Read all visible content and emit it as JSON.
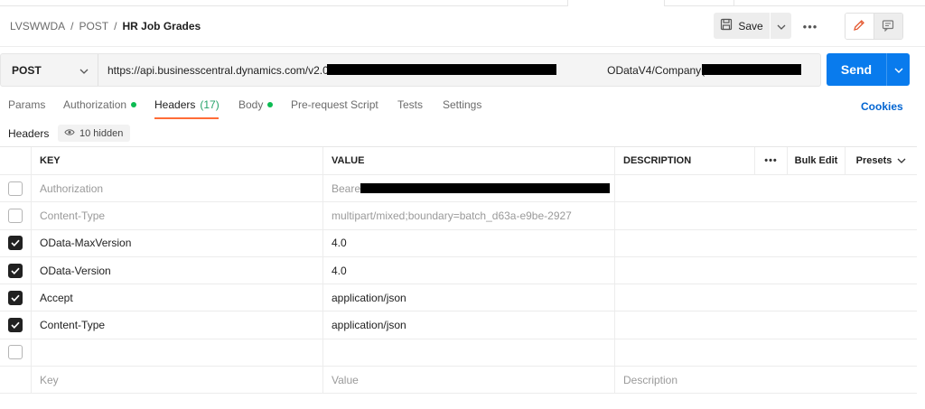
{
  "breadcrumb": {
    "workspace": "LVSWWDA",
    "sep": "/",
    "collection": "POST",
    "request": "HR Job Grades"
  },
  "toolbar": {
    "save_label": "Save",
    "more_label": "•••"
  },
  "request": {
    "method": "POST",
    "url_start": "https://api.businesscentral.dynamics.com/v2.0/",
    "url_mid": "ODataV4/Company('",
    "send_label": "Send"
  },
  "tabs": [
    {
      "label": "Params"
    },
    {
      "label": "Authorization",
      "dot": true
    },
    {
      "label": "Headers",
      "count": "(17)"
    },
    {
      "label": "Body",
      "dot": true
    },
    {
      "label": "Pre-request Script"
    },
    {
      "label": "Tests"
    },
    {
      "label": "Settings"
    }
  ],
  "cookies_label": "Cookies",
  "headers_section": {
    "title": "Headers",
    "hidden_label": "10 hidden"
  },
  "table": {
    "columns": {
      "key": "KEY",
      "value": "VALUE",
      "description": "DESCRIPTION",
      "more": "•••",
      "bulk_edit": "Bulk Edit",
      "presets": "Presets"
    },
    "rows": [
      {
        "checked": false,
        "auto": true,
        "key": "Authorization",
        "value": "Bearer"
      },
      {
        "checked": false,
        "auto": true,
        "key": "Content-Type",
        "value": "multipart/mixed;boundary=batch_d63a-e9be-2927"
      },
      {
        "checked": true,
        "auto": false,
        "key": "OData-MaxVersion",
        "value": "4.0"
      },
      {
        "checked": true,
        "auto": false,
        "key": "OData-Version",
        "value": "4.0"
      },
      {
        "checked": true,
        "auto": false,
        "key": "Accept",
        "value": "application/json"
      },
      {
        "checked": true,
        "auto": false,
        "key": "Content-Type",
        "value": "application/json"
      }
    ],
    "placeholders": {
      "key": "Key",
      "value": "Value",
      "description": "Description"
    }
  },
  "colors": {
    "accent": "#ff6c37",
    "send": "#097bed",
    "link": "#0265d2",
    "dot": "#0cbb52"
  }
}
